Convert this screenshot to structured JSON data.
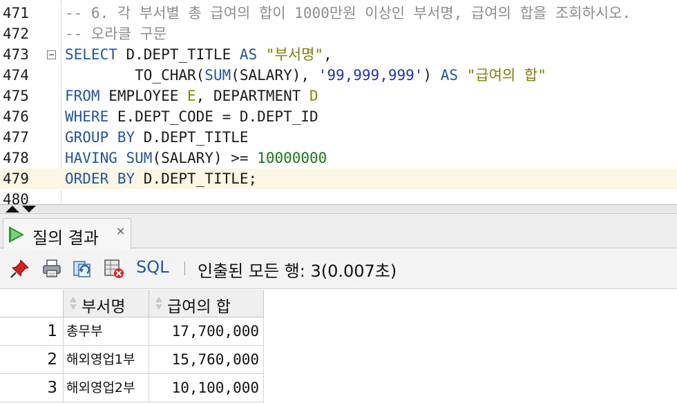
{
  "editor": {
    "lines": [
      {
        "no": "471",
        "current": false,
        "fold": false,
        "tokens": [
          {
            "t": "-- 6. 각 부서별 총 급여의 합이 1000만원 이상인 부서명, 급여의 합을 조회하시오.",
            "c": "cmt"
          }
        ]
      },
      {
        "no": "472",
        "current": false,
        "fold": false,
        "tokens": [
          {
            "t": "-- 오라클 구문",
            "c": "cmt"
          }
        ]
      },
      {
        "no": "473",
        "current": false,
        "fold": true,
        "tokens": [
          {
            "t": "SELECT",
            "c": "kw"
          },
          {
            "t": " D.DEPT_TITLE ",
            "c": ""
          },
          {
            "t": "AS",
            "c": "kw"
          },
          {
            "t": " ",
            "c": ""
          },
          {
            "t": "\"부서명\"",
            "c": "str"
          },
          {
            "t": ",",
            "c": ""
          }
        ]
      },
      {
        "no": "474",
        "current": false,
        "fold": false,
        "tokens": [
          {
            "t": "        TO_CHAR(",
            "c": ""
          },
          {
            "t": "SUM",
            "c": "kw"
          },
          {
            "t": "(SALARY), ",
            "c": ""
          },
          {
            "t": "'99,999,999'",
            "c": "lit"
          },
          {
            "t": ") ",
            "c": ""
          },
          {
            "t": "AS",
            "c": "kw"
          },
          {
            "t": " ",
            "c": ""
          },
          {
            "t": "\"급여의 합\"",
            "c": "str"
          }
        ]
      },
      {
        "no": "475",
        "current": false,
        "fold": false,
        "tokens": [
          {
            "t": "FROM",
            "c": "kw"
          },
          {
            "t": " EMPLOYEE ",
            "c": ""
          },
          {
            "t": "E",
            "c": "alias"
          },
          {
            "t": ", DEPARTMENT ",
            "c": ""
          },
          {
            "t": "D",
            "c": "alias"
          }
        ]
      },
      {
        "no": "476",
        "current": false,
        "fold": false,
        "tokens": [
          {
            "t": "WHERE",
            "c": "kw"
          },
          {
            "t": " E.DEPT_CODE = D.DEPT_ID",
            "c": ""
          }
        ]
      },
      {
        "no": "477",
        "current": false,
        "fold": false,
        "tokens": [
          {
            "t": "GROUP BY",
            "c": "kw"
          },
          {
            "t": " D.DEPT_TITLE",
            "c": ""
          }
        ]
      },
      {
        "no": "478",
        "current": false,
        "fold": false,
        "tokens": [
          {
            "t": "HAVING",
            "c": "kw"
          },
          {
            "t": " ",
            "c": ""
          },
          {
            "t": "SUM",
            "c": "kw"
          },
          {
            "t": "(SALARY) >= ",
            "c": ""
          },
          {
            "t": "10000000",
            "c": "num"
          }
        ]
      },
      {
        "no": "479",
        "current": true,
        "fold": false,
        "tokens": [
          {
            "t": "ORDER BY",
            "c": "kw"
          },
          {
            "t": " D.DEPT_TITLE;",
            "c": ""
          }
        ]
      },
      {
        "no": "480",
        "current": false,
        "fold": false,
        "tokens": []
      }
    ]
  },
  "results_tab": {
    "label": "질의 결과",
    "close": "×"
  },
  "toolbar": {
    "sql_label": "SQL",
    "status": "인출된 모든 행: 3(0.007초)"
  },
  "grid": {
    "columns": [
      "부서명",
      "급여의 합"
    ],
    "rows": [
      {
        "num": "1",
        "dept": "총무부",
        "sum": "17,700,000"
      },
      {
        "num": "2",
        "dept": "해외영업1부",
        "sum": "15,760,000"
      },
      {
        "num": "3",
        "dept": "해외영업2부",
        "sum": "10,100,000"
      }
    ]
  },
  "colors": {
    "keyword": "#1f55a5",
    "string": "#7f7f00",
    "literal": "#1b33c8",
    "number": "#127a12",
    "comment": "#8c8c8c",
    "current_line": "#fcf7e4",
    "run_icon": "#2a9a2a"
  }
}
